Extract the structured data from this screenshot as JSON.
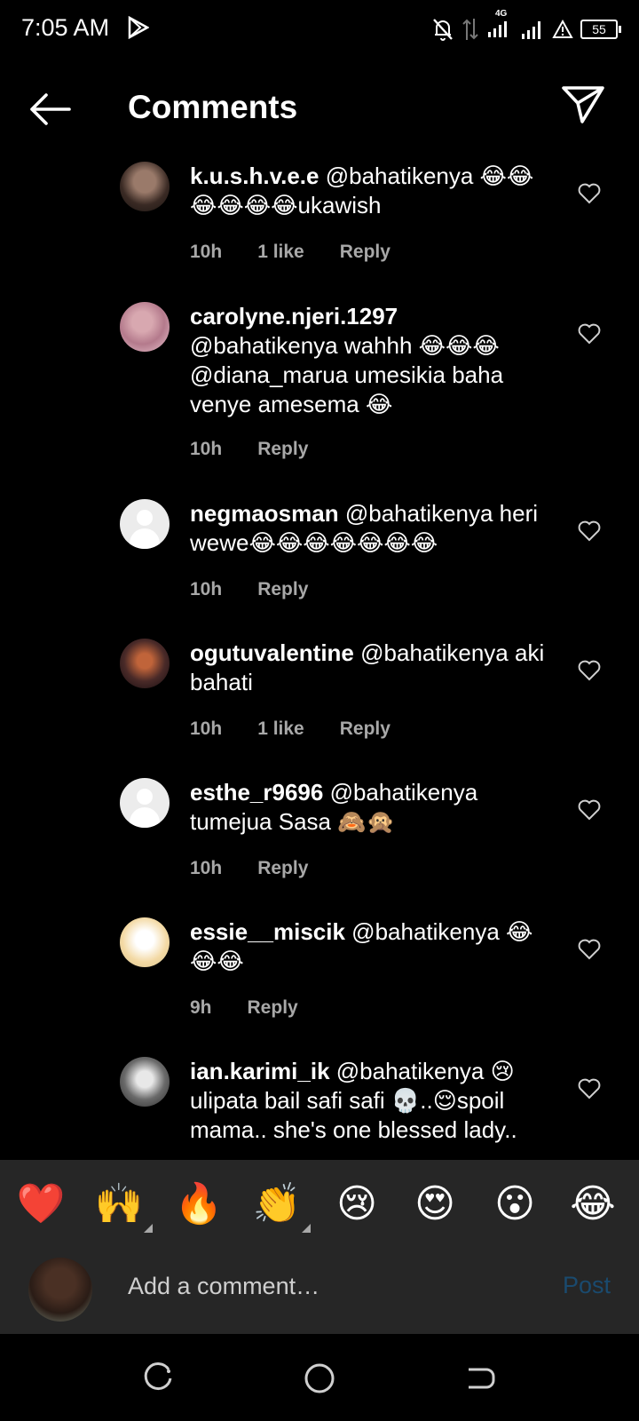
{
  "status_bar": {
    "time": "7:05 AM",
    "network": "4G",
    "battery": "55",
    "icons": [
      "play-store-icon",
      "mute-bell-icon",
      "data-arrows-icon",
      "signal-icon",
      "signal-icon-2",
      "alert-icon",
      "battery-icon"
    ]
  },
  "header": {
    "title": "Comments",
    "back_icon": "back-arrow-icon",
    "send_icon": "send-paper-plane-icon"
  },
  "comments": [
    {
      "username": "k.u.s.h.v.e.e",
      "text": "@bahatikenya 😂😂😂😂😂😂ukawish",
      "time": "10h",
      "likes": "1 like",
      "reply": "Reply",
      "avatar": "photo"
    },
    {
      "username": "carolyne.njeri.1297",
      "text": "@bahatikenya  wahhh 😂😂😂 @diana_marua  umesikia  baha venye amesema 😂",
      "time": "10h",
      "likes": "",
      "reply": "Reply",
      "avatar": "photo2"
    },
    {
      "username": "negmaosman",
      "text": "@bahatikenya heri wewe😂😂😂😂😂😂😂",
      "time": "10h",
      "likes": "",
      "reply": "Reply",
      "avatar": "default"
    },
    {
      "username": "ogutuvalentine",
      "text": "@bahatikenya aki bahati",
      "time": "10h",
      "likes": "1 like",
      "reply": "Reply",
      "avatar": "photo3"
    },
    {
      "username": "esthe_r9696",
      "text": "@bahatikenya tumejua Sasa 🙈🙊",
      "time": "10h",
      "likes": "",
      "reply": "Reply",
      "avatar": "default"
    },
    {
      "username": "essie__miscik",
      "text": "@bahatikenya 😂😂😂",
      "time": "9h",
      "likes": "",
      "reply": "Reply",
      "avatar": "photo4"
    },
    {
      "username": "ian.karimi_ik",
      "text": "@bahatikenya 😢 ulipata bail safi safi 💀..😌spoil mama.. she's one blessed lady..",
      "time": "",
      "likes": "",
      "reply": "",
      "avatar": "photo5"
    }
  ],
  "emoji_bar": [
    {
      "glyph": "❤️",
      "name": "red-heart",
      "has_variants": false
    },
    {
      "glyph": "🙌",
      "name": "raising-hands",
      "has_variants": true
    },
    {
      "glyph": "🔥",
      "name": "fire",
      "has_variants": false
    },
    {
      "glyph": "👏",
      "name": "clapping-hands",
      "has_variants": true
    },
    {
      "glyph": "😢",
      "name": "crying-face",
      "has_variants": false
    },
    {
      "glyph": "😍",
      "name": "heart-eyes",
      "has_variants": false
    },
    {
      "glyph": "😮",
      "name": "surprised-face",
      "has_variants": false
    },
    {
      "glyph": "😂",
      "name": "tears-of-joy",
      "has_variants": false
    }
  ],
  "composer": {
    "placeholder": "Add a comment…",
    "post_label": "Post"
  },
  "nav": [
    "recent-apps-icon",
    "home-icon",
    "back-icon"
  ],
  "colors": {
    "background": "#000000",
    "panel": "#262626",
    "secondary_text": "#a8a8a8",
    "post_disabled": "#1a4a6e"
  }
}
